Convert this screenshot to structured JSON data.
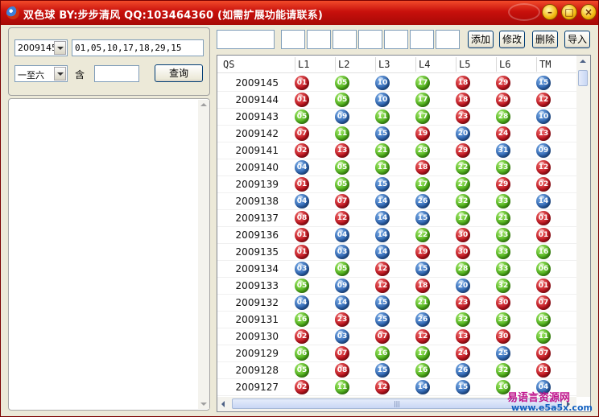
{
  "window": {
    "title": "双色球  BY:步步清风  QQ:103464360  (如需扩展功能请联系)"
  },
  "controls": {
    "issue_select": "2009145",
    "numbers_input": "01,05,10,17,18,29,15",
    "range_select": "一至六",
    "contains_label": "含",
    "contains_input": "",
    "query_button": "查询"
  },
  "toolbar": {
    "add": "添加",
    "edit": "修改",
    "delete": "删除",
    "import": "导入"
  },
  "columns": [
    "QS",
    "L1",
    "L2",
    "L3",
    "L4",
    "L5",
    "L6",
    "TM"
  ],
  "colors": {
    "red": "#c2141e",
    "green": "#4fb21a",
    "blue": "#2e66b4"
  },
  "rows": [
    {
      "qs": "2009145",
      "balls": [
        [
          "01",
          "red"
        ],
        [
          "05",
          "green"
        ],
        [
          "10",
          "blue"
        ],
        [
          "17",
          "green"
        ],
        [
          "18",
          "red"
        ],
        [
          "29",
          "red"
        ],
        [
          "15",
          "blue"
        ]
      ]
    },
    {
      "qs": "2009144",
      "balls": [
        [
          "01",
          "red"
        ],
        [
          "05",
          "green"
        ],
        [
          "10",
          "blue"
        ],
        [
          "17",
          "green"
        ],
        [
          "18",
          "red"
        ],
        [
          "29",
          "red"
        ],
        [
          "12",
          "red"
        ]
      ]
    },
    {
      "qs": "2009143",
      "balls": [
        [
          "05",
          "green"
        ],
        [
          "09",
          "blue"
        ],
        [
          "11",
          "green"
        ],
        [
          "17",
          "green"
        ],
        [
          "23",
          "red"
        ],
        [
          "28",
          "green"
        ],
        [
          "10",
          "blue"
        ]
      ]
    },
    {
      "qs": "2009142",
      "balls": [
        [
          "07",
          "red"
        ],
        [
          "11",
          "green"
        ],
        [
          "15",
          "blue"
        ],
        [
          "19",
          "red"
        ],
        [
          "20",
          "blue"
        ],
        [
          "24",
          "red"
        ],
        [
          "13",
          "red"
        ]
      ]
    },
    {
      "qs": "2009141",
      "balls": [
        [
          "02",
          "red"
        ],
        [
          "13",
          "red"
        ],
        [
          "21",
          "green"
        ],
        [
          "28",
          "green"
        ],
        [
          "29",
          "red"
        ],
        [
          "31",
          "blue"
        ],
        [
          "09",
          "blue"
        ]
      ]
    },
    {
      "qs": "2009140",
      "balls": [
        [
          "04",
          "blue"
        ],
        [
          "05",
          "green"
        ],
        [
          "11",
          "green"
        ],
        [
          "18",
          "red"
        ],
        [
          "22",
          "green"
        ],
        [
          "33",
          "green"
        ],
        [
          "12",
          "red"
        ]
      ]
    },
    {
      "qs": "2009139",
      "balls": [
        [
          "01",
          "red"
        ],
        [
          "05",
          "green"
        ],
        [
          "15",
          "blue"
        ],
        [
          "17",
          "green"
        ],
        [
          "27",
          "green"
        ],
        [
          "29",
          "red"
        ],
        [
          "02",
          "red"
        ]
      ]
    },
    {
      "qs": "2009138",
      "balls": [
        [
          "04",
          "blue"
        ],
        [
          "07",
          "red"
        ],
        [
          "14",
          "blue"
        ],
        [
          "26",
          "blue"
        ],
        [
          "32",
          "green"
        ],
        [
          "33",
          "green"
        ],
        [
          "14",
          "blue"
        ]
      ]
    },
    {
      "qs": "2009137",
      "balls": [
        [
          "08",
          "red"
        ],
        [
          "12",
          "red"
        ],
        [
          "14",
          "blue"
        ],
        [
          "15",
          "blue"
        ],
        [
          "17",
          "green"
        ],
        [
          "21",
          "green"
        ],
        [
          "01",
          "red"
        ]
      ]
    },
    {
      "qs": "2009136",
      "balls": [
        [
          "01",
          "red"
        ],
        [
          "04",
          "blue"
        ],
        [
          "14",
          "blue"
        ],
        [
          "22",
          "green"
        ],
        [
          "30",
          "red"
        ],
        [
          "33",
          "green"
        ],
        [
          "01",
          "red"
        ]
      ]
    },
    {
      "qs": "2009135",
      "balls": [
        [
          "01",
          "red"
        ],
        [
          "03",
          "blue"
        ],
        [
          "14",
          "blue"
        ],
        [
          "19",
          "red"
        ],
        [
          "30",
          "red"
        ],
        [
          "33",
          "green"
        ],
        [
          "16",
          "green"
        ]
      ]
    },
    {
      "qs": "2009134",
      "balls": [
        [
          "03",
          "blue"
        ],
        [
          "05",
          "green"
        ],
        [
          "12",
          "red"
        ],
        [
          "15",
          "blue"
        ],
        [
          "28",
          "green"
        ],
        [
          "33",
          "green"
        ],
        [
          "06",
          "green"
        ]
      ]
    },
    {
      "qs": "2009133",
      "balls": [
        [
          "05",
          "green"
        ],
        [
          "09",
          "blue"
        ],
        [
          "12",
          "red"
        ],
        [
          "18",
          "red"
        ],
        [
          "20",
          "blue"
        ],
        [
          "32",
          "green"
        ],
        [
          "01",
          "red"
        ]
      ]
    },
    {
      "qs": "2009132",
      "balls": [
        [
          "04",
          "blue"
        ],
        [
          "14",
          "blue"
        ],
        [
          "15",
          "blue"
        ],
        [
          "21",
          "green"
        ],
        [
          "23",
          "red"
        ],
        [
          "30",
          "red"
        ],
        [
          "07",
          "red"
        ]
      ]
    },
    {
      "qs": "2009131",
      "balls": [
        [
          "16",
          "green"
        ],
        [
          "23",
          "red"
        ],
        [
          "25",
          "blue"
        ],
        [
          "26",
          "blue"
        ],
        [
          "32",
          "green"
        ],
        [
          "33",
          "green"
        ],
        [
          "05",
          "green"
        ]
      ]
    },
    {
      "qs": "2009130",
      "balls": [
        [
          "02",
          "red"
        ],
        [
          "03",
          "blue"
        ],
        [
          "07",
          "red"
        ],
        [
          "12",
          "red"
        ],
        [
          "13",
          "red"
        ],
        [
          "30",
          "red"
        ],
        [
          "11",
          "green"
        ]
      ]
    },
    {
      "qs": "2009129",
      "balls": [
        [
          "06",
          "green"
        ],
        [
          "07",
          "red"
        ],
        [
          "16",
          "green"
        ],
        [
          "17",
          "green"
        ],
        [
          "24",
          "red"
        ],
        [
          "25",
          "blue"
        ],
        [
          "07",
          "red"
        ]
      ]
    },
    {
      "qs": "2009128",
      "balls": [
        [
          "05",
          "green"
        ],
        [
          "08",
          "red"
        ],
        [
          "15",
          "blue"
        ],
        [
          "16",
          "green"
        ],
        [
          "26",
          "blue"
        ],
        [
          "32",
          "green"
        ],
        [
          "01",
          "red"
        ]
      ]
    },
    {
      "qs": "2009127",
      "balls": [
        [
          "02",
          "red"
        ],
        [
          "11",
          "green"
        ],
        [
          "12",
          "red"
        ],
        [
          "14",
          "blue"
        ],
        [
          "15",
          "blue"
        ],
        [
          "16",
          "green"
        ],
        [
          "04",
          "blue"
        ]
      ]
    }
  ],
  "watermark": {
    "main": "易语言资源网",
    "sub": "www.e5a5x.com"
  }
}
